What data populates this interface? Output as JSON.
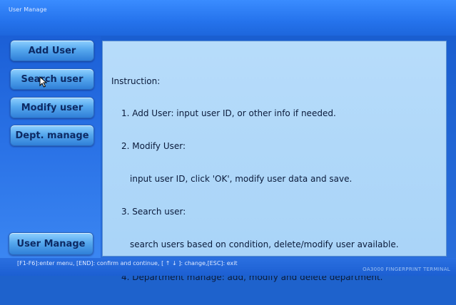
{
  "window": {
    "title": "User Manage"
  },
  "nav": {
    "add_user": "Add User",
    "search_user": "Search user",
    "modify_user": "Modify user",
    "dept_manage": "Dept. manage",
    "user_manage": "User Manage"
  },
  "instruction": {
    "heading": "Instruction:",
    "lines": [
      "1. Add User: input user ID, or other info if needed.",
      "2. Modify User:",
      "input user ID, click 'OK', modify user data and save.",
      "3. Search user:",
      "search users based on condition, delete/modify user available.",
      "4. Department manage: add, modify and delete department."
    ]
  },
  "status": {
    "hint": "[F1-F6]:enter menu, [END]: confirm and continue, [ ↑ ↓ ]: change,[ESC]: exit",
    "device": "OA3000 FINGERPRINT TERMINAL"
  },
  "cursor": {
    "icon": "mouse-pointer-icon"
  }
}
